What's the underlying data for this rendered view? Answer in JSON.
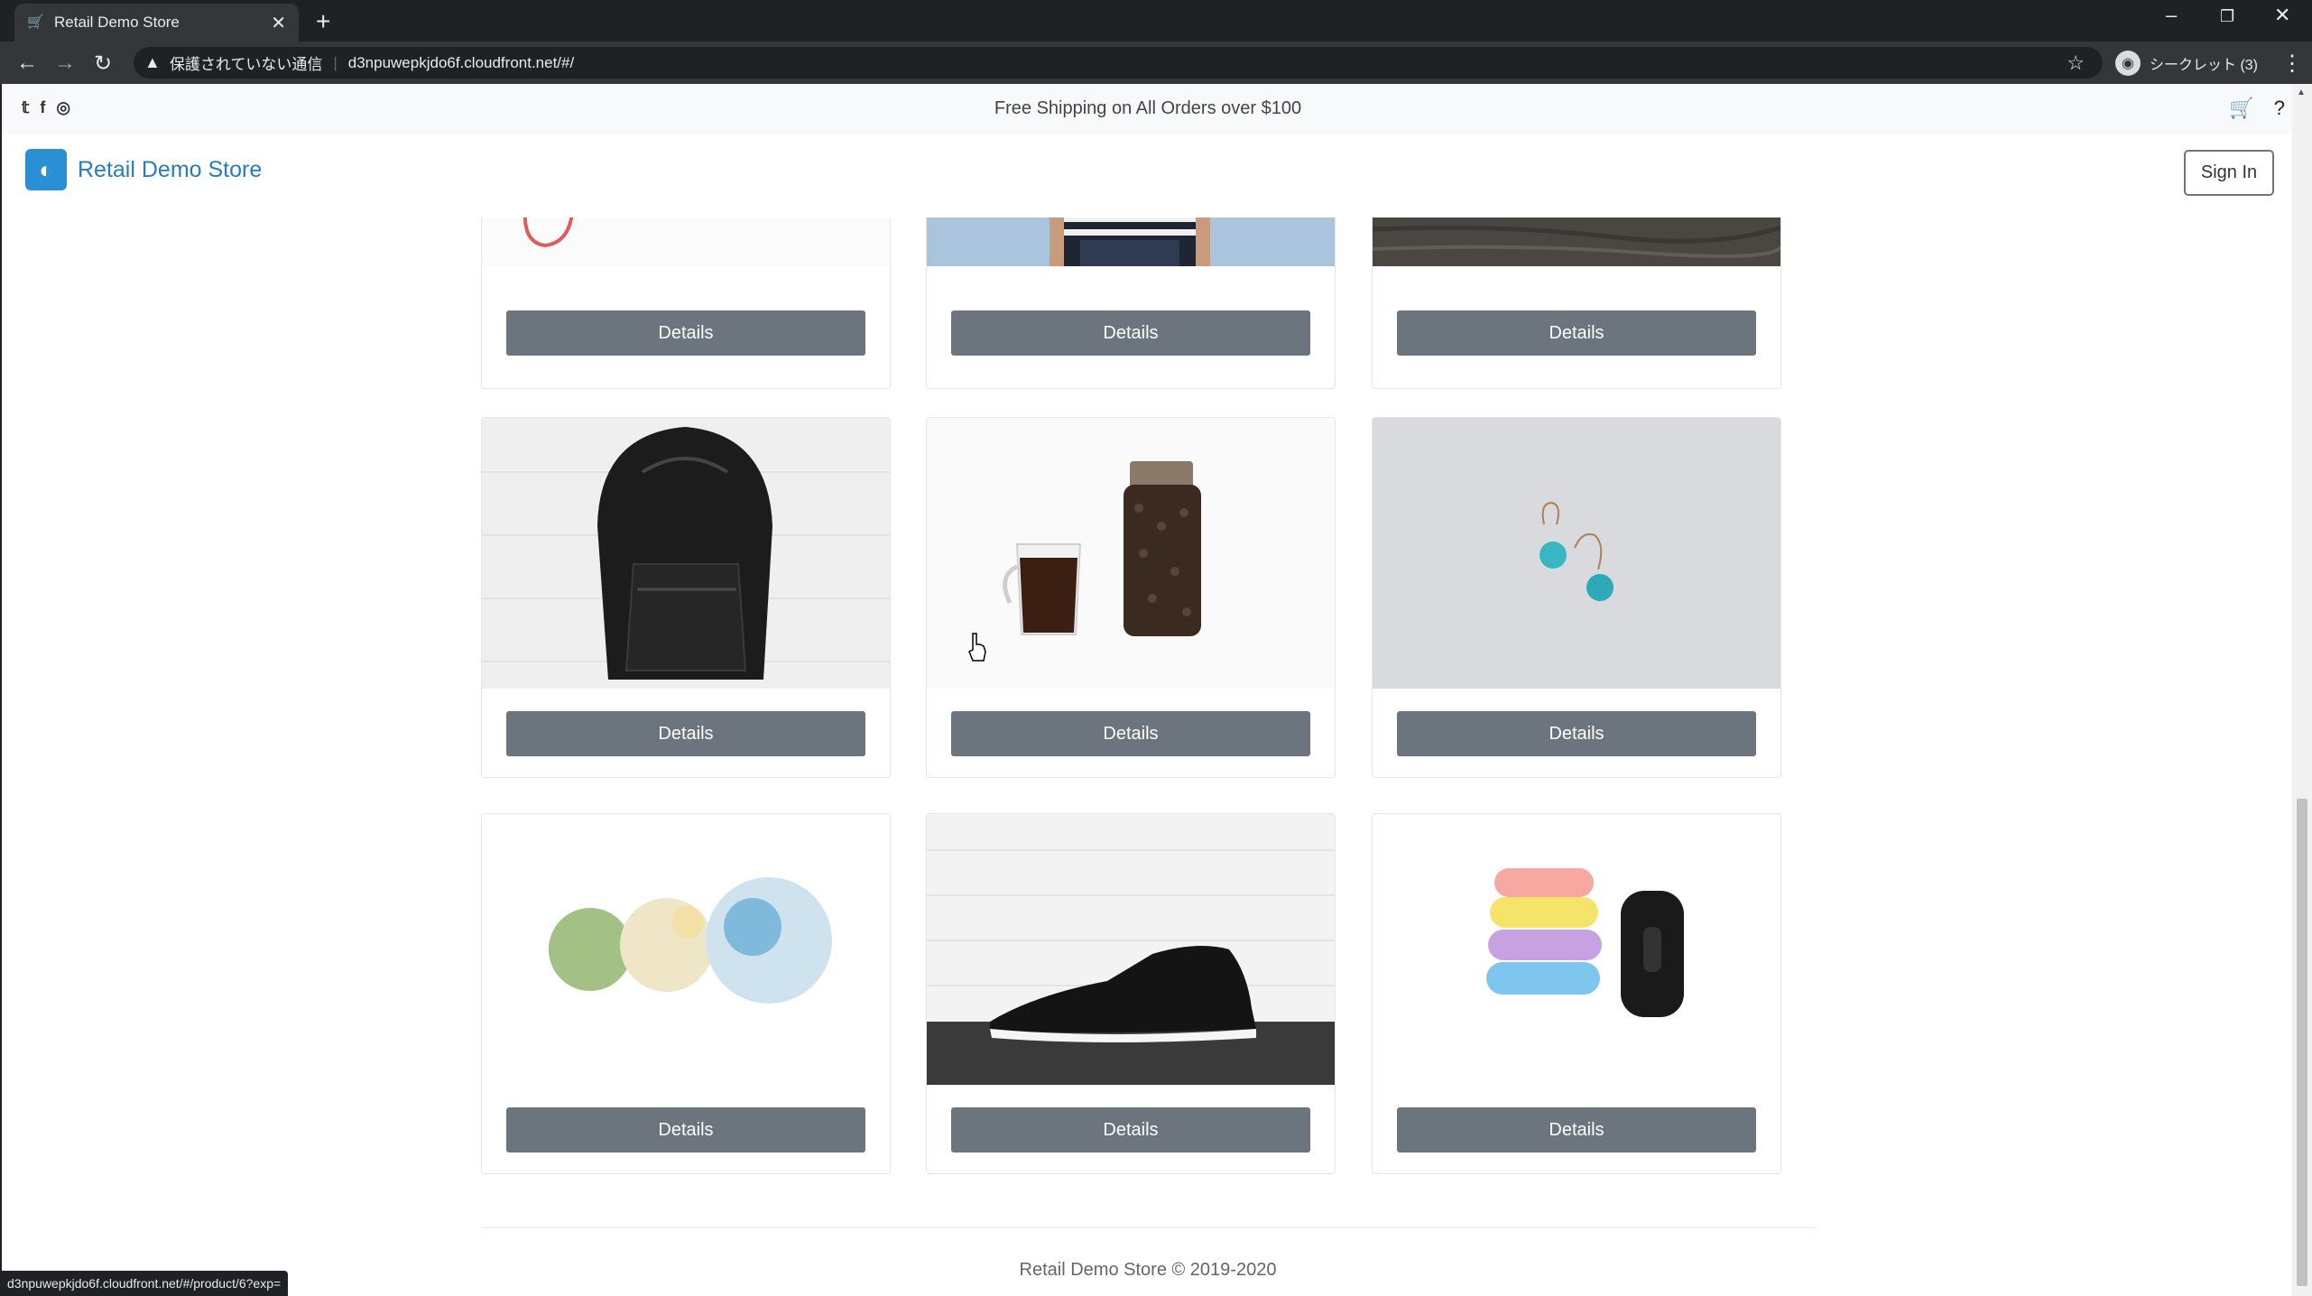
{
  "browser": {
    "tab_title": "Retail Demo Store",
    "tab_icon": "cart-icon",
    "security_warning": "保護されていない通信",
    "url": "d3npuwepkjdo6f.cloudfront.net/#/",
    "incognito_label": "シークレット (3)",
    "status_url": "d3npuwepkjdo6f.cloudfront.net/#/product/6?exp="
  },
  "promo": {
    "text": "Free Shipping on All Orders over $100",
    "social_icons": [
      "twitter-icon",
      "facebook-icon",
      "instagram-icon"
    ]
  },
  "header": {
    "brand": "Retail Demo Store",
    "sign_in": "Sign In"
  },
  "products": {
    "details_label": "Details",
    "items": [
      {
        "image": "necklace"
      },
      {
        "image": "striped-shirt"
      },
      {
        "image": "wood-texture"
      },
      {
        "image": "black-backpack"
      },
      {
        "image": "coffee-and-beans"
      },
      {
        "image": "turquoise-earrings"
      },
      {
        "image": "bath-bombs"
      },
      {
        "image": "black-sneaker"
      },
      {
        "image": "fitness-tracker-bands"
      }
    ]
  },
  "footer": {
    "copyright": "Retail Demo Store © 2019-2020"
  },
  "colors": {
    "brand": "#2b7bb9",
    "button": "#6c757d",
    "chrome": "#35363a"
  }
}
